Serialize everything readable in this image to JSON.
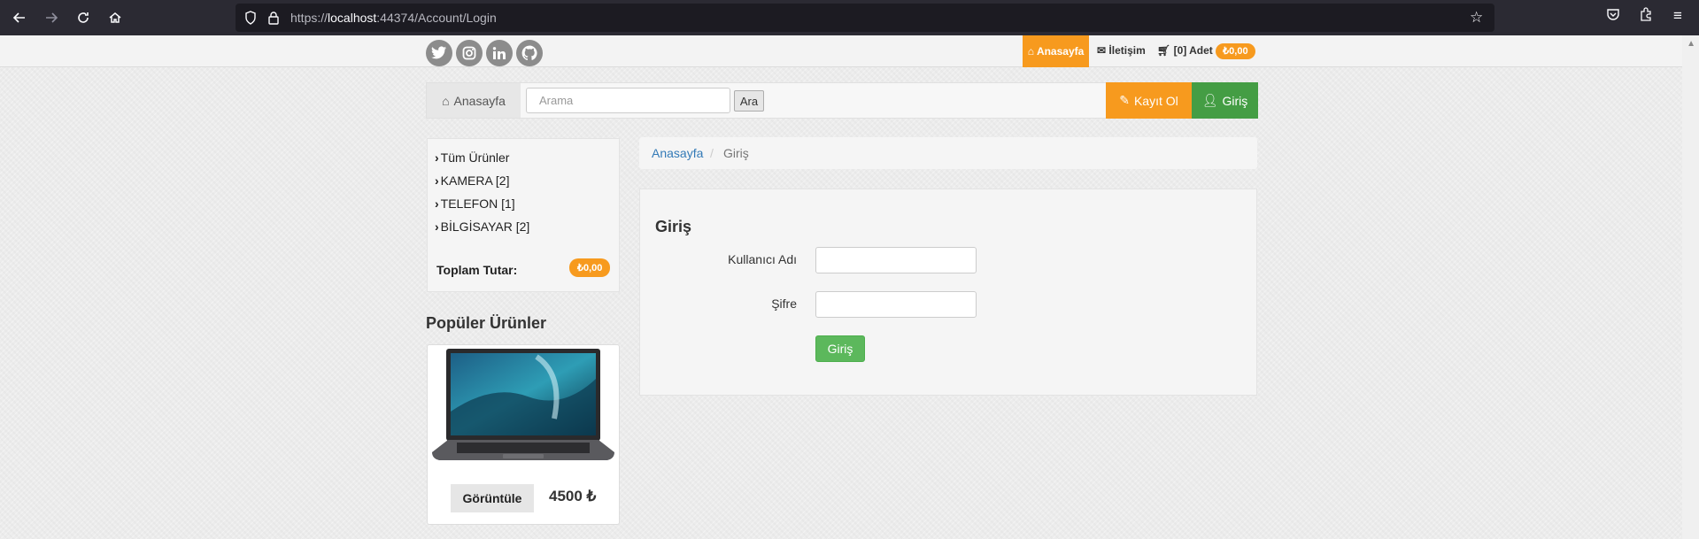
{
  "browser": {
    "url_prefix": "https://",
    "url_host": "localhost",
    "url_rest": ":44374/Account/Login"
  },
  "topbar": {
    "home_label": "Anasayfa",
    "contact_label": "İletişim",
    "cart_label": "[0] Adet",
    "cart_total": "₺0,00"
  },
  "navbar": {
    "home_label": "Anasayfa",
    "search_placeholder": "Arama",
    "search_button": "Ara",
    "register_label": "Kayıt Ol",
    "login_label": "Giriş"
  },
  "sidebar": {
    "categories": [
      {
        "label": "Tüm Ürünler"
      },
      {
        "label": "KAMERA [2]"
      },
      {
        "label": "TELEFON [1]"
      },
      {
        "label": "BİLGİSAYAR [2]"
      }
    ],
    "total_label": "Toplam Tutar:",
    "total_value": "₺0,00",
    "popular_title": "Popüler Ürünler",
    "product": {
      "view_label": "Görüntüle",
      "price": "4500 ₺"
    }
  },
  "breadcrumb": {
    "home": "Anasayfa",
    "separator": "/",
    "current": "Giriş"
  },
  "login_form": {
    "title": "Giriş",
    "username_label": "Kullanıcı Adı",
    "password_label": "Şifre",
    "submit_label": "Giriş"
  },
  "colors": {
    "accent_orange": "#f79a1e",
    "success_green": "#449d44",
    "link_blue": "#337ab7"
  }
}
